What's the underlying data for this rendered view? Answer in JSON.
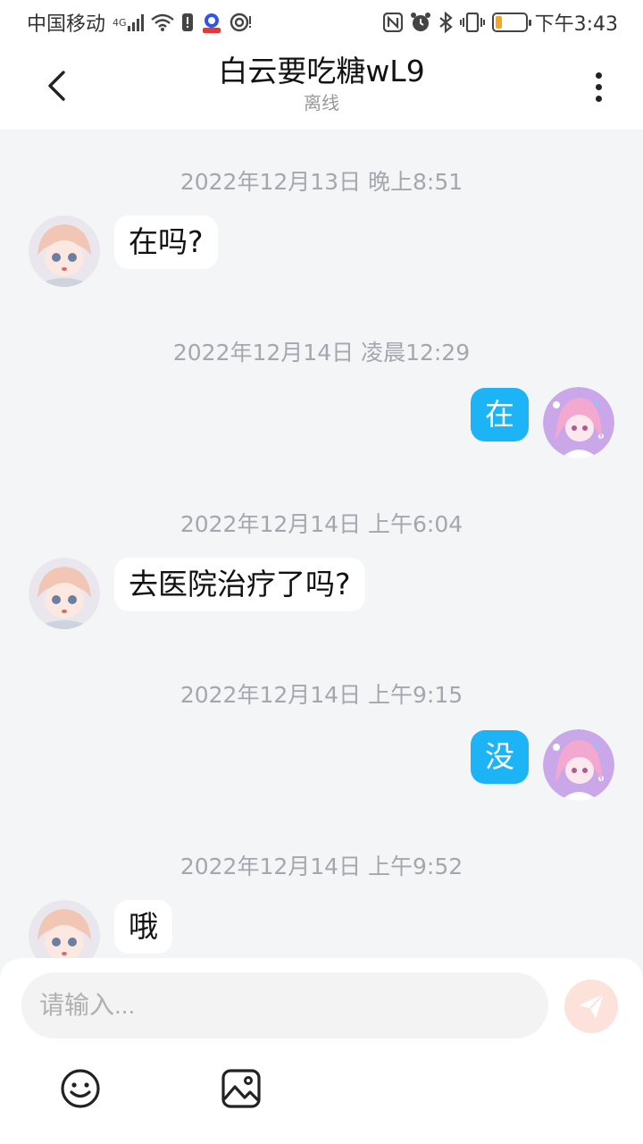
{
  "status_bar": {
    "carrier": "中国移动",
    "network": "4G",
    "time": "下午3:43",
    "battery_color": "#f5a623"
  },
  "header": {
    "title": "白云要吃糖wL9",
    "status": "离线"
  },
  "messages": [
    {
      "timestamp": "2022年12月13日 晚上8:51",
      "side": "in",
      "text": "在吗?"
    },
    {
      "timestamp": "2022年12月14日 凌晨12:29",
      "side": "out",
      "text": "在"
    },
    {
      "timestamp": "2022年12月14日 上午6:04",
      "side": "in",
      "text": "去医院治疗了吗?"
    },
    {
      "timestamp": "2022年12月14日 上午9:15",
      "side": "out",
      "text": "没"
    },
    {
      "timestamp": "2022年12月14日 上午9:52",
      "side": "in",
      "text": "哦"
    }
  ],
  "composer": {
    "placeholder": "请输入...",
    "send_icon": "send-icon",
    "emoji_icon": "emoji-icon",
    "image_icon": "image-icon"
  },
  "colors": {
    "outgoing_bubble": "#1cb4f7",
    "incoming_bubble": "#ffffff",
    "background": "#f4f5f7",
    "send_button": "#fde2dc"
  }
}
